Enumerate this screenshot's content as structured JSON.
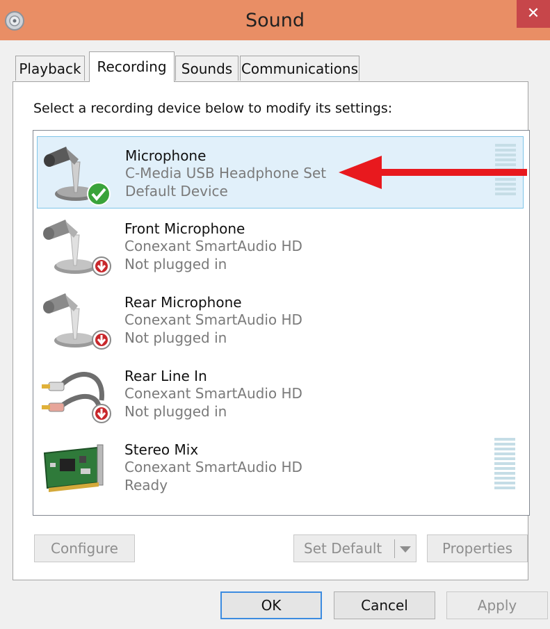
{
  "window": {
    "title": "Sound",
    "close_glyph": "✕",
    "app_icon": "speaker-icon"
  },
  "tabs": [
    {
      "label": "Playback"
    },
    {
      "label": "Recording"
    },
    {
      "label": "Sounds"
    },
    {
      "label": "Communications"
    }
  ],
  "active_tab": "Recording",
  "instruction": "Select a recording device below to modify its settings:",
  "devices": [
    {
      "name": "Microphone",
      "driver": "C-Media USB Headphone Set",
      "status": "Default Device",
      "icon": "microphone-icon",
      "badge": "default-check-icon",
      "selected": true
    },
    {
      "name": "Front Microphone",
      "driver": "Conexant SmartAudio HD",
      "status": "Not plugged in",
      "icon": "microphone-icon",
      "badge": "unplugged-icon",
      "selected": false
    },
    {
      "name": "Rear Microphone",
      "driver": "Conexant SmartAudio HD",
      "status": "Not plugged in",
      "icon": "microphone-icon",
      "badge": "unplugged-icon",
      "selected": false
    },
    {
      "name": "Rear Line In",
      "driver": "Conexant SmartAudio HD",
      "status": "Not plugged in",
      "icon": "rca-cable-icon",
      "badge": "unplugged-icon",
      "selected": false
    },
    {
      "name": "Stereo Mix",
      "driver": "Conexant SmartAudio HD",
      "status": "Ready",
      "icon": "sound-card-icon",
      "badge": "",
      "selected": false
    }
  ],
  "buttons": {
    "configure": "Configure",
    "set_default": "Set Default",
    "properties": "Properties",
    "ok": "OK",
    "cancel": "Cancel",
    "apply": "Apply"
  },
  "colors": {
    "titlebar": "#e98e65",
    "close": "#c7464a",
    "selection": "#e1f0fa",
    "annotation_arrow": "#e8191e"
  }
}
